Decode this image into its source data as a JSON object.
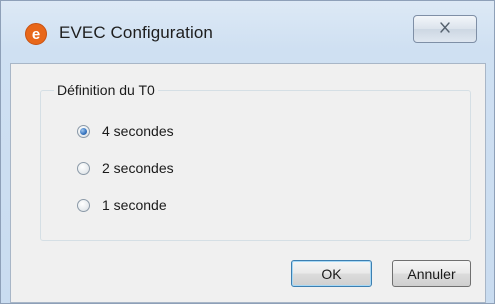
{
  "window": {
    "title": "EVEC Configuration",
    "app_icon": "evec-app-icon",
    "close_icon": "close-icon"
  },
  "group": {
    "title": "Définition du T0",
    "options": [
      {
        "label": "4 secondes",
        "checked": true
      },
      {
        "label": "2 secondes",
        "checked": false
      },
      {
        "label": "1 seconde",
        "checked": false
      }
    ]
  },
  "buttons": {
    "ok_label": "OK",
    "cancel_label": "Annuler"
  },
  "colors": {
    "accent": "#e8671a",
    "titlebar": "#d6e5f4",
    "client": "#f0f0f0"
  }
}
